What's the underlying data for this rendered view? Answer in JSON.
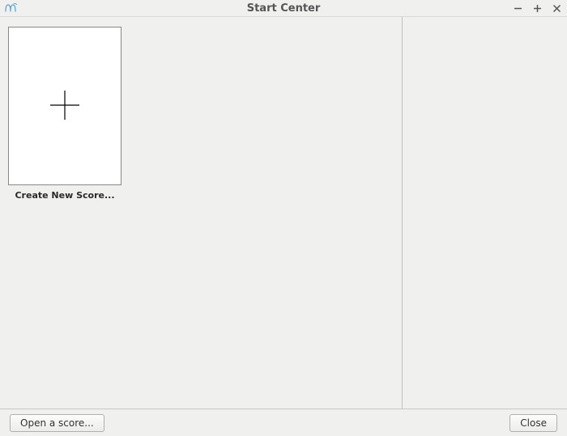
{
  "window": {
    "title": "Start Center",
    "icon_name": "musescore-app-icon"
  },
  "main": {
    "tiles": [
      {
        "label": "Create New Score...",
        "kind": "new"
      }
    ]
  },
  "footer": {
    "open_button": "Open a score...",
    "close_button": "Close"
  }
}
